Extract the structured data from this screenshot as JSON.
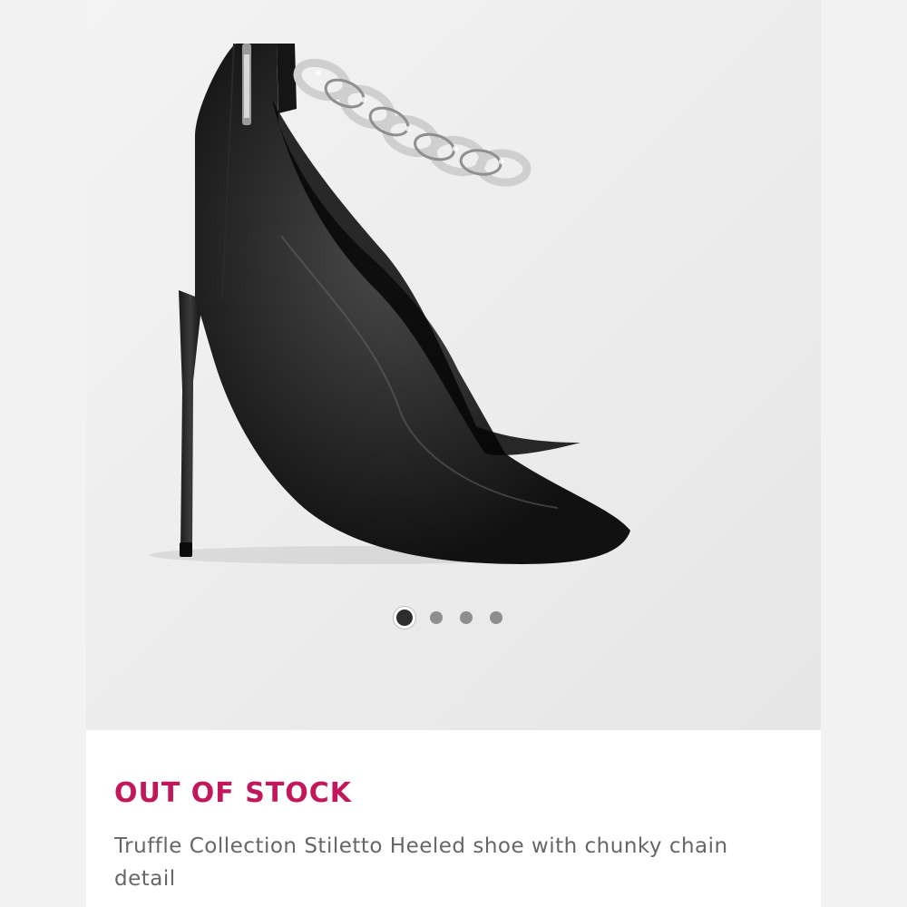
{
  "gallery": {
    "image_alt": "Black leather pointed stiletto pump with chunky silver chain ankle strap",
    "slide_count": 4,
    "active_slide": 1
  },
  "product": {
    "status": "OUT OF STOCK",
    "title": "Truffle Collection Stiletto Heeled shoe with chunky chain detail"
  },
  "colors": {
    "status_red": "#c2185b",
    "text_grey": "#666666",
    "dot_active": "#2d2d2d",
    "dot_inactive": "#8e8e8e"
  }
}
